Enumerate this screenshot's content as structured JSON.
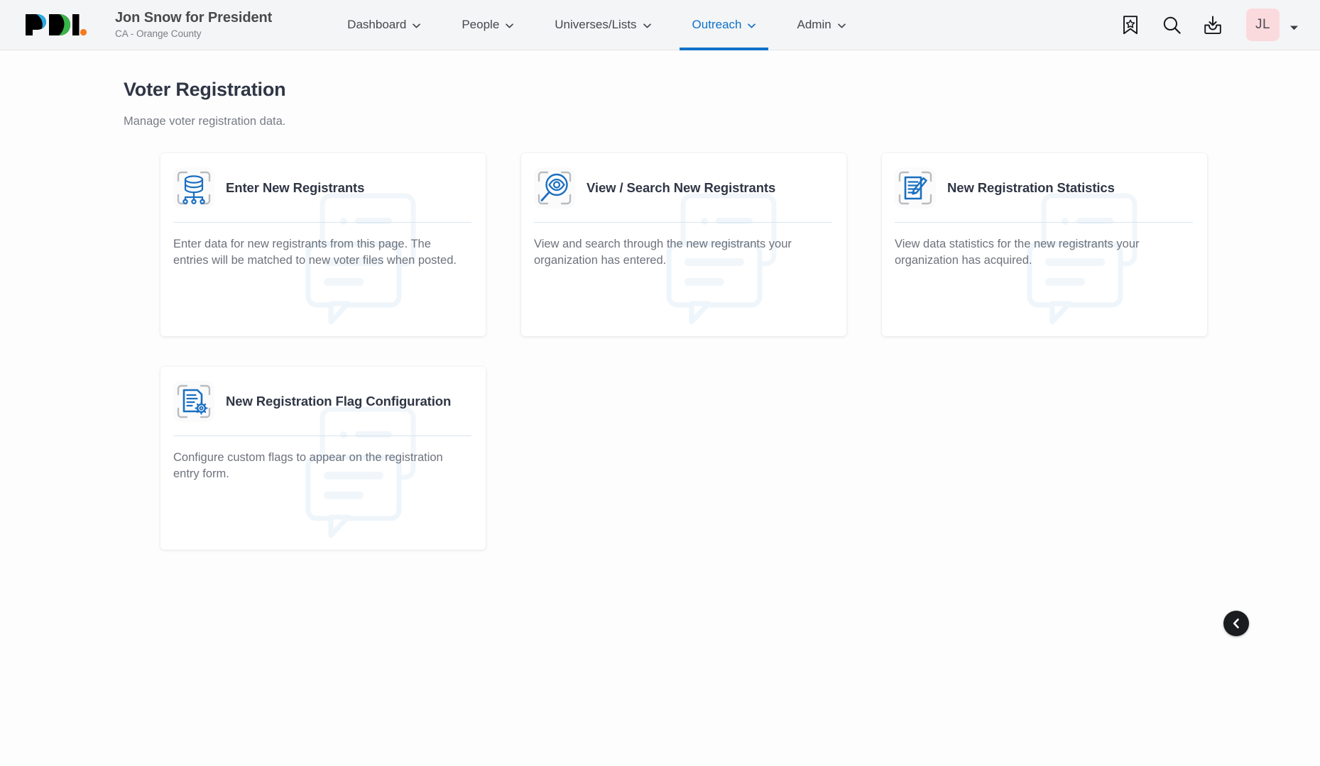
{
  "brand": {
    "logo_text": "PDI.",
    "logo_name": "pdi-logo",
    "colors": {
      "blue": "#29abe2",
      "green": "#39b54a",
      "orange": "#f47b20",
      "black": "#000000"
    }
  },
  "header": {
    "org_name": "Jon Snow for President",
    "org_sublabel": "CA - Orange County",
    "nav": [
      {
        "label": "Dashboard",
        "active": false,
        "icon": "chevron-down-icon"
      },
      {
        "label": "People",
        "active": false,
        "icon": "chevron-down-icon"
      },
      {
        "label": "Universes/Lists",
        "active": false,
        "icon": "chevron-down-icon"
      },
      {
        "label": "Outreach",
        "active": true,
        "icon": "chevron-down-icon"
      },
      {
        "label": "Admin",
        "active": false,
        "icon": "chevron-down-icon"
      }
    ],
    "actions": [
      {
        "name": "bookmark-star-icon",
        "label": "Bookmarks"
      },
      {
        "name": "search-icon",
        "label": "Search"
      },
      {
        "name": "inbox-download-icon",
        "label": "Downloads"
      }
    ],
    "avatar": {
      "initials": "JL",
      "background": "#fbdadd",
      "menu_icon": "chevron-down-icon"
    },
    "accent_color": "#0f72c9"
  },
  "page": {
    "title": "Voter Registration",
    "subtitle": "Manage voter registration data."
  },
  "cards": [
    {
      "title": "Enter New Registrants",
      "description": "Enter data for new registrants from this page. The entries will be matched to new voter files when posted.",
      "icon": "database-nodes-icon",
      "slug": "enter-new-registrants"
    },
    {
      "title": "View / Search New Registrants",
      "description": "View and search through the new registrants your organization has entered.",
      "icon": "eye-magnifier-icon",
      "slug": "view-search-new-registrants"
    },
    {
      "title": "New Registration Statistics",
      "description": "View data statistics for the new registrants your organization has acquired.",
      "icon": "document-pencil-icon",
      "slug": "new-registration-statistics"
    },
    {
      "title": "New Registration Flag Configuration",
      "description": "Configure custom flags to appear on the registration entry form.",
      "icon": "document-gear-icon",
      "slug": "new-registration-flag-configuration"
    }
  ],
  "floating": {
    "back_button": {
      "name": "back-button",
      "icon": "chevron-left-icon",
      "label": "Back"
    }
  }
}
